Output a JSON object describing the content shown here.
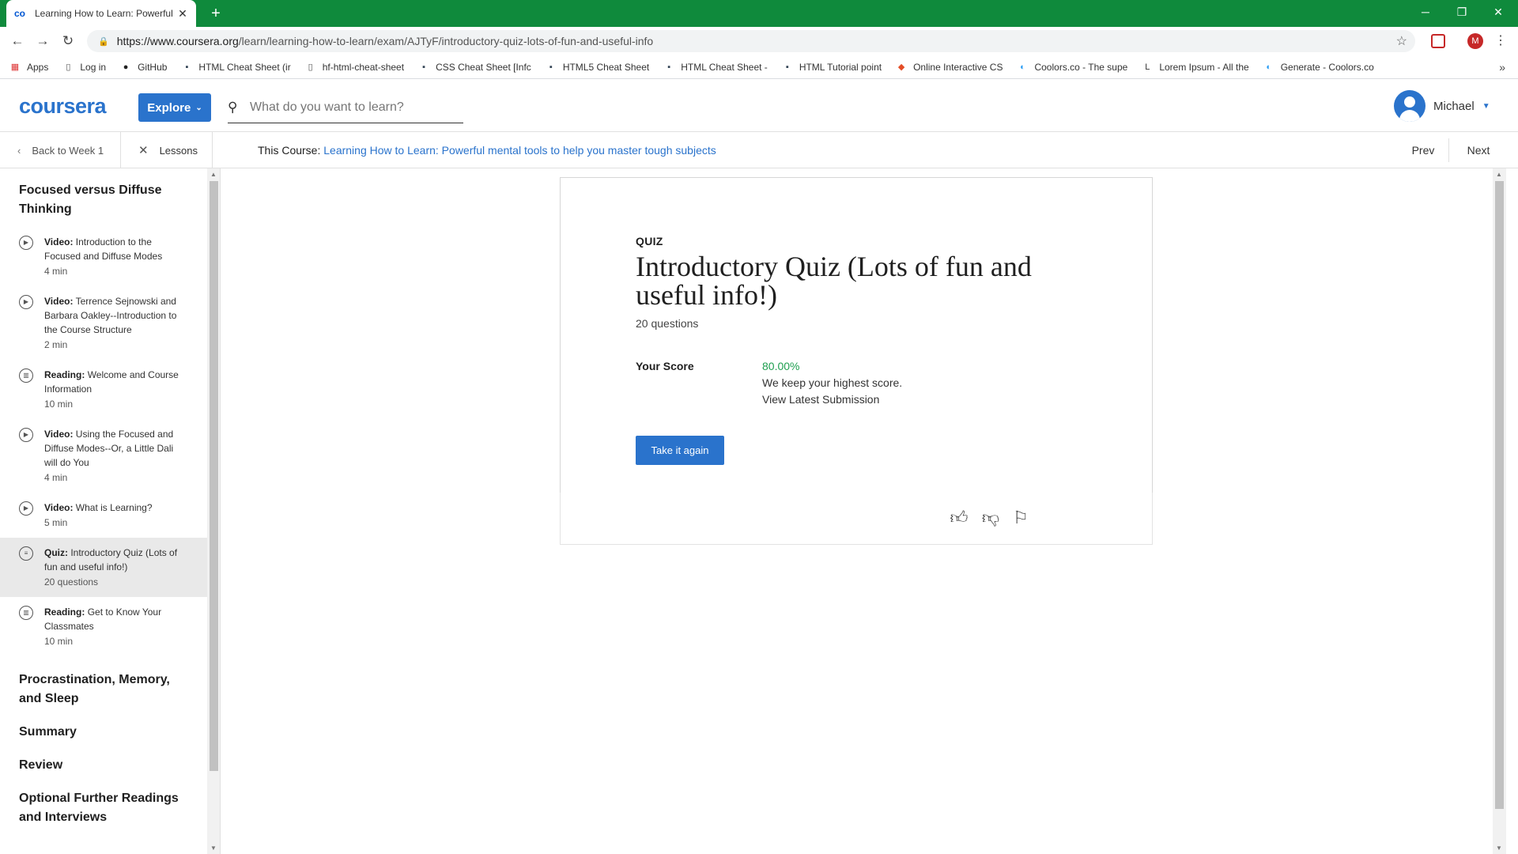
{
  "browser": {
    "tab_title": "Learning How to Learn: Powerful",
    "url_domain": "https://www.coursera.org",
    "url_path": "/learn/learning-how-to-learn/exam/AJTyF/introductory-quiz-lots-of-fun-and-useful-info",
    "profile_initial": "M",
    "bookmarks": [
      {
        "label": "Apps",
        "icon": "apps-grid-icon"
      },
      {
        "label": "Log in",
        "icon": "page-icon"
      },
      {
        "label": "GitHub",
        "icon": "github-icon"
      },
      {
        "label": "HTML Cheat Sheet (ir",
        "icon": "bookmark-icon"
      },
      {
        "label": "hf-html-cheat-sheet",
        "icon": "page-icon"
      },
      {
        "label": "CSS Cheat Sheet [Infc",
        "icon": "bookmark-icon"
      },
      {
        "label": "HTML5 Cheat Sheet",
        "icon": "bookmark-icon"
      },
      {
        "label": "HTML Cheat Sheet -",
        "icon": "bookmark-icon"
      },
      {
        "label": "HTML Tutorial point",
        "icon": "bookmark-icon"
      },
      {
        "label": "Online Interactive CS",
        "icon": "html5-icon"
      },
      {
        "label": "Coolors.co - The supe",
        "icon": "coolors-icon"
      },
      {
        "label": "Lorem Ipsum - All the",
        "icon": "lorem-icon"
      },
      {
        "label": "Generate - Coolors.co",
        "icon": "coolors-icon"
      }
    ]
  },
  "header": {
    "logo": "coursera",
    "explore_label": "Explore",
    "search_placeholder": "What do you want to learn?",
    "user_name": "Michael"
  },
  "coursebar": {
    "back_label": "Back to Week 1",
    "lessons_label": "Lessons",
    "course_prefix": "This Course:",
    "course_title": "Learning How to Learn: Powerful mental tools to help you master tough subjects",
    "prev_label": "Prev",
    "next_label": "Next"
  },
  "sidebar": {
    "module_title": "Focused versus Diffuse Thinking",
    "items": [
      {
        "type": "Video:",
        "title": "Introduction to the Focused and Diffuse Modes",
        "meta": "4 min",
        "icon": "play-icon",
        "active": false
      },
      {
        "type": "Video:",
        "title": "Terrence Sejnowski and Barbara Oakley--Introduction to the Course Structure",
        "meta": "2 min",
        "icon": "play-icon",
        "active": false
      },
      {
        "type": "Reading:",
        "title": "Welcome and Course Information",
        "meta": "10 min",
        "icon": "book-icon",
        "active": false
      },
      {
        "type": "Video:",
        "title": "Using the Focused and Diffuse Modes--Or, a Little Dali will do You",
        "meta": "4 min",
        "icon": "play-icon",
        "active": false
      },
      {
        "type": "Video:",
        "title": "What is Learning?",
        "meta": "5 min",
        "icon": "play-icon",
        "active": false
      },
      {
        "type": "Quiz:",
        "title": "Introductory Quiz (Lots of fun and useful info!)",
        "meta": "20 questions",
        "icon": "quiz-icon",
        "active": true
      },
      {
        "type": "Reading:",
        "title": "Get to Know Your Classmates",
        "meta": "10 min",
        "icon": "book-icon",
        "active": false
      }
    ],
    "other_modules": [
      "Procrastination, Memory, and Sleep",
      "Summary",
      "Review",
      "Optional Further Readings and Interviews"
    ]
  },
  "quiz": {
    "label": "QUIZ",
    "title": "Introductory Quiz (Lots of fun and useful info!)",
    "count": "20 questions",
    "score_label": "Your Score",
    "score_value": "80.00%",
    "score_note": "We keep your highest score.",
    "submission_link": "View Latest Submission",
    "retake_label": "Take it again"
  },
  "colors": {
    "accent": "#2a73cc",
    "score": "#1f9f50",
    "tabstrip": "#0f8a3c"
  }
}
